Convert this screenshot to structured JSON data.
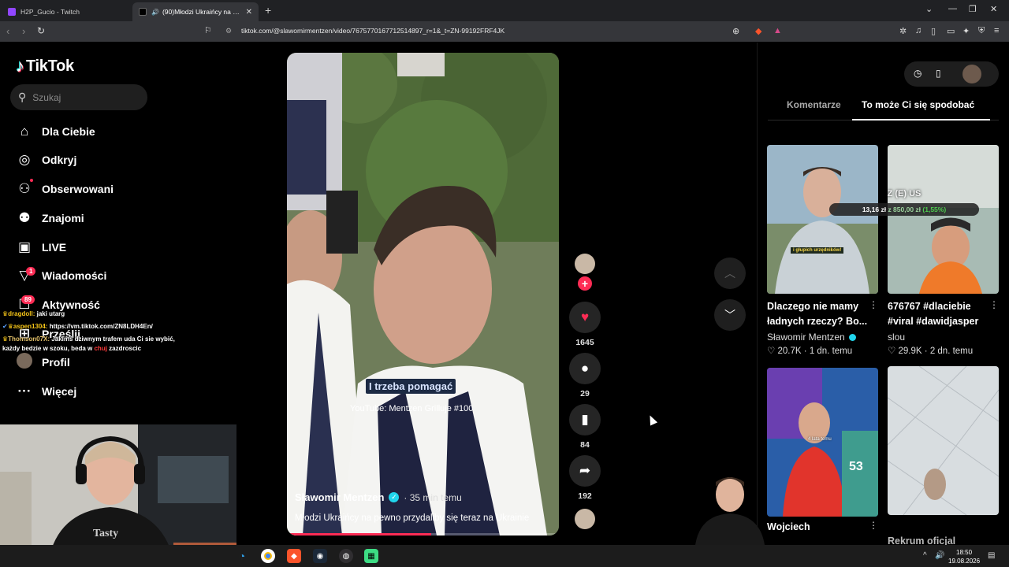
{
  "browser": {
    "tabs": [
      {
        "title": "H2P_Gucio - Twitch",
        "color": "#9146ff"
      },
      {
        "title": "(90)Młodzi Ukraińcy na pewno",
        "color": "#000000"
      }
    ],
    "new_tab": "+",
    "url": "tiktok.com/@slawomirmentzen/video/7675770167712514897_r=1&_t=ZN-99192FRF4JK"
  },
  "tiktok": {
    "logo": "TikTok",
    "search_placeholder": "Szukaj",
    "menu": [
      {
        "label": "Dla Ciebie",
        "icon": "home-icon"
      },
      {
        "label": "Odkryj",
        "icon": "compass-icon"
      },
      {
        "label": "Obserwowani",
        "icon": "following-icon"
      },
      {
        "label": "Znajomi",
        "icon": "friends-icon"
      },
      {
        "label": "LIVE",
        "icon": "live-icon"
      },
      {
        "label": "Wiadomości",
        "icon": "messages-icon",
        "badge": "1"
      },
      {
        "label": "Aktywność",
        "icon": "activity-icon",
        "badge": "89"
      },
      {
        "label": "Prześlij",
        "icon": "upload-icon"
      },
      {
        "label": "Profil",
        "icon": "profile-icon"
      },
      {
        "label": "Więcej",
        "icon": "more-icon"
      }
    ]
  },
  "chat": [
    {
      "user": "dragdoll:",
      "text": " jaki utarg"
    },
    {
      "user": "aspen1304:",
      "text": " https://vm.tiktok.com/ZN8LDH4En/"
    },
    {
      "user": "Thomson07X:",
      "text": " Jakimś dziwnym trafem uda Ci sie wybić,"
    },
    {
      "text_a": "każdy bedzie w szoku, beda w ",
      "text_red": "chuj",
      "text_b": " zazdroscic"
    }
  ],
  "video": {
    "subtitle": "I trzeba pomagać",
    "source": "YouTube: Mentzen Grilluje #100",
    "author": "Sławomir Mentzen",
    "time": "· 35 min temu",
    "description": "Młodzi Ukraińcy na pewno przydaliby się teraz na Ukrainie",
    "progress": 0.53
  },
  "actions": {
    "likes": "1645",
    "comments": "29",
    "saves": "84",
    "shares": "192"
  },
  "right_panel": {
    "tab_comments": "Komentarze",
    "tab_recommended": "To może Ci się spodobać",
    "cards": [
      {
        "title": "Dlaczego nie mamy ładnych rzeczy? Bo...",
        "author": "Sławomir Mentzen",
        "verified": true,
        "likes": "20.7K",
        "age": "1 dn. temu",
        "caption": "i głupich urzędników!"
      },
      {
        "title": "676767 #dlaciebie #viral #dawidjasper",
        "author": "slou",
        "verified": false,
        "likes": "29.9K",
        "age": "2 dn. temu"
      },
      {
        "title": "Wojciech",
        "overlay": "4 lata temu",
        "number": "53"
      },
      {
        "title": "Rekrum oficjal"
      }
    ],
    "stock_overlay": {
      "label": "Z (E) US",
      "value": "13,16 zł",
      "of": "z 850,00 zł",
      "pct": "(1,55%)"
    }
  },
  "taskbar": {
    "time": "18:50",
    "date": "19.08.2026"
  }
}
